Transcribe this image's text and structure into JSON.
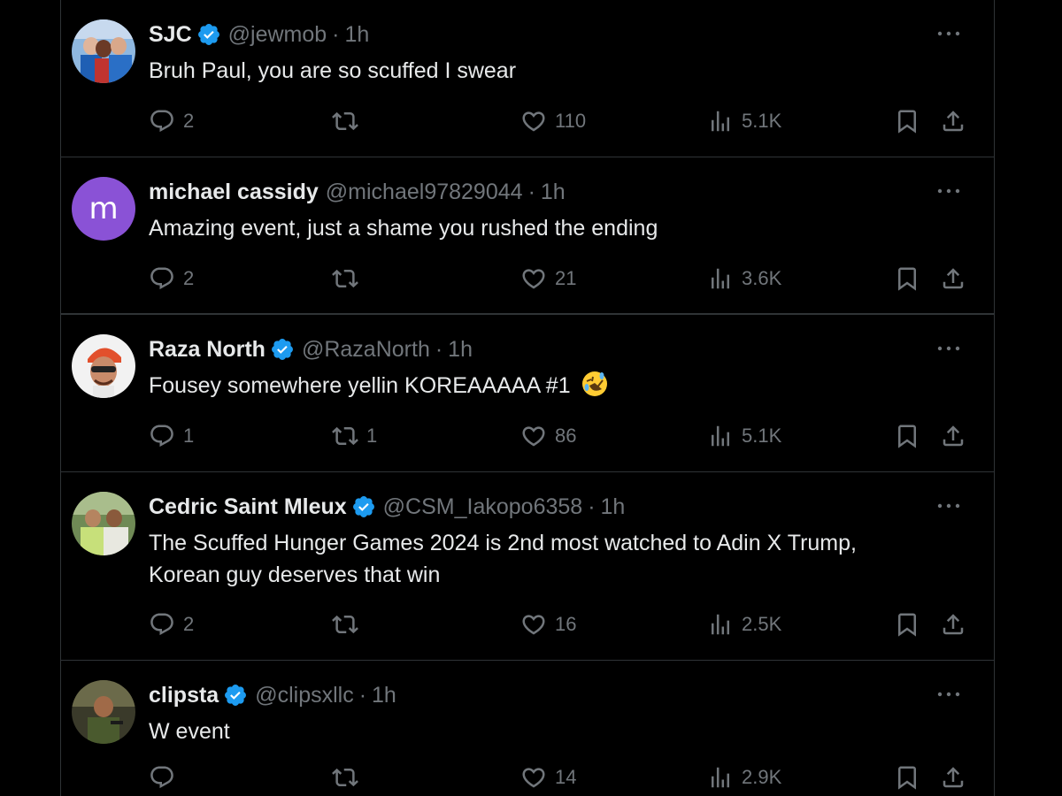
{
  "tweets": [
    {
      "name": "SJC",
      "verified": true,
      "handle": "@jewmob",
      "time": "1h",
      "text": "Bruh Paul, you are so scuffed I swear",
      "replies": "2",
      "retweets": "",
      "likes": "110",
      "views": "5.1K",
      "avatar": "photo-avatar"
    },
    {
      "name": "michael cassidy",
      "verified": false,
      "handle": "@michael97829044",
      "time": "1h",
      "text": "Amazing event, just a shame you rushed the ending",
      "replies": "2",
      "retweets": "",
      "likes": "21",
      "views": "3.6K",
      "avatar_letter": "m",
      "avatar_color": "#8a52d6"
    },
    {
      "name": "Raza North",
      "verified": true,
      "handle": "@RazaNorth",
      "time": "1h",
      "text": "Fousey somewhere yellin KOREAAAAA #1",
      "emoji": "rolling-on-floor-laughing-emoji",
      "replies": "1",
      "retweets": "1",
      "likes": "86",
      "views": "5.1K",
      "avatar": "photo-avatar"
    },
    {
      "name": "Cedric Saint Mleux",
      "verified": true,
      "handle": "@CSM_Iakopo6358",
      "time": "1h",
      "text_line1": "The Scuffed Hunger Games 2024 is 2nd most watched to Adin X Trump,",
      "text_line2": "Korean guy deserves that win",
      "replies": "2",
      "retweets": "",
      "likes": "16",
      "views": "2.5K",
      "avatar": "photo-avatar"
    },
    {
      "name": "clipsta",
      "verified": true,
      "handle": "@clipsxllc",
      "time": "1h",
      "text": "W event",
      "replies": "",
      "retweets": "",
      "likes": "14",
      "views": "2.9K",
      "avatar": "photo-avatar"
    }
  ],
  "separator": "·",
  "icons": {
    "reply": "reply-icon",
    "retweet": "retweet-icon",
    "like": "heart-icon",
    "views": "views-icon",
    "bookmark": "bookmark-icon",
    "share": "share-icon",
    "more": "more-icon",
    "verified": "verified-badge-icon"
  },
  "colors": {
    "background": "#000000",
    "text": "#e7e9ea",
    "muted": "#71767b",
    "divider": "#2f3336",
    "verified": "#1d9bf0"
  }
}
